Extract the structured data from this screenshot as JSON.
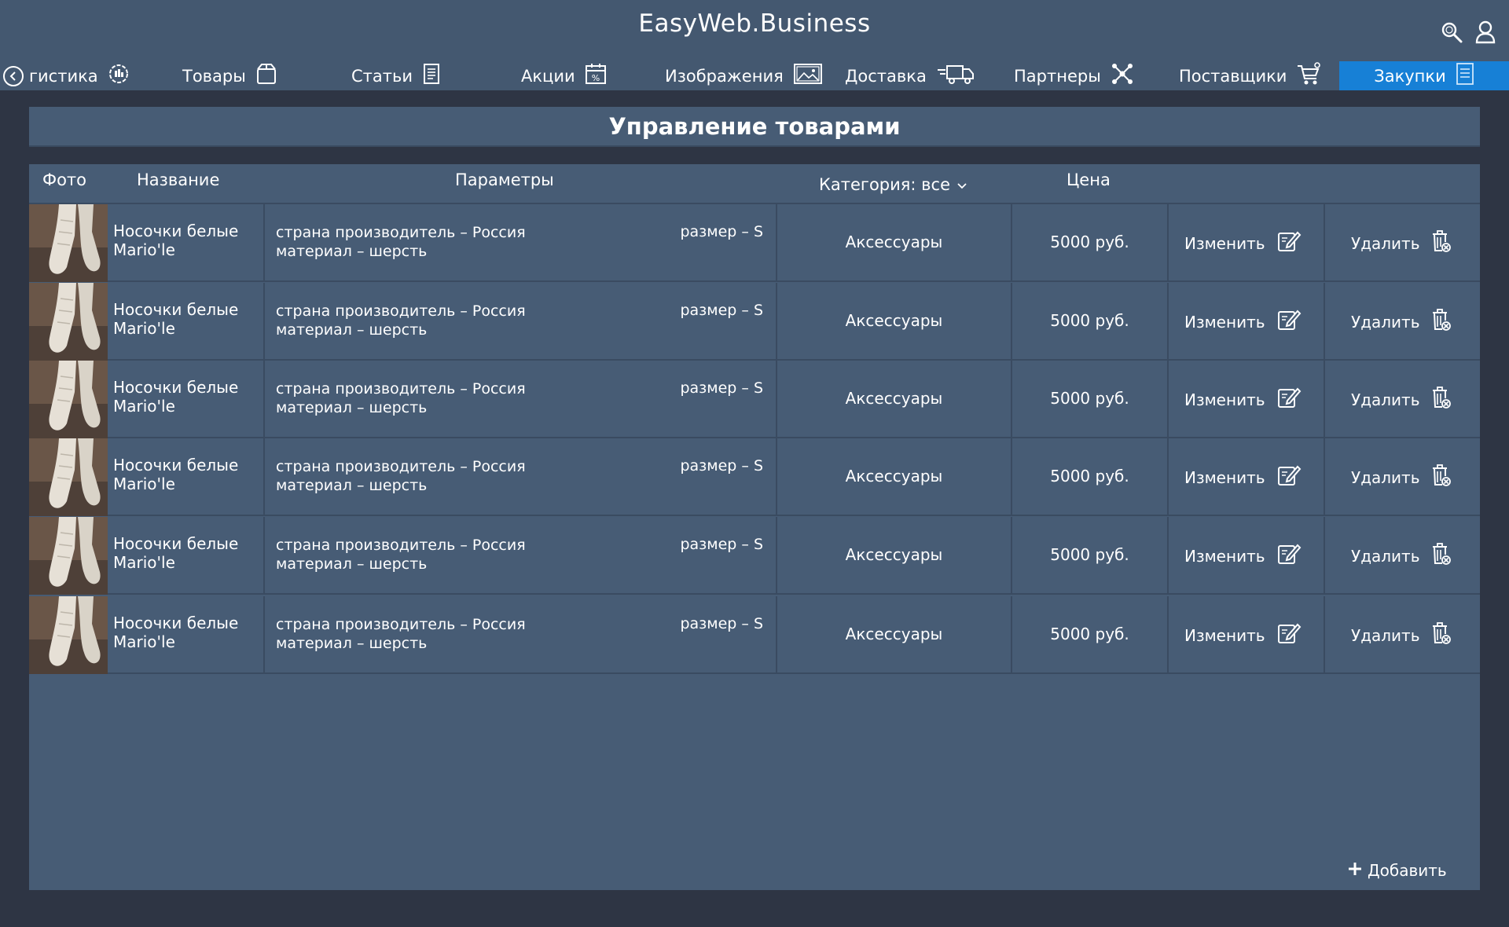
{
  "app": {
    "title": "EasyWeb.Business"
  },
  "header": {
    "search_icon": "search-icon",
    "user_icon": "user-icon"
  },
  "nav": {
    "items": [
      {
        "label": "гистика",
        "icon": "logistics-icon"
      },
      {
        "label": "Товары",
        "icon": "box-icon"
      },
      {
        "label": "Статьи",
        "icon": "document-icon"
      },
      {
        "label": "Акции",
        "icon": "percent-calendar-icon"
      },
      {
        "label": "Изображения",
        "icon": "image-icon"
      },
      {
        "label": "Доставка",
        "icon": "truck-icon"
      },
      {
        "label": "Партнеры",
        "icon": "network-icon"
      },
      {
        "label": "Поставщики",
        "icon": "cart-icon"
      },
      {
        "label": "Закупки",
        "icon": "list-icon",
        "active": true
      }
    ]
  },
  "main": {
    "title": "Управление товарами",
    "columns": {
      "photo": "Фото",
      "name": "Название",
      "params": "Параметры",
      "category": "Категория: все",
      "price": "Цена"
    },
    "rows": [
      {
        "name": "Носочки белые Mario'le",
        "param1": "страна производитель – Россия",
        "param2": "материал – шерсть",
        "size": "размер – S",
        "category": "Аксессуары",
        "price": "5000 руб.",
        "edit": "Изменить",
        "delete": "Удалить"
      },
      {
        "name": "Носочки белые Mario'le",
        "param1": "страна производитель – Россия",
        "param2": "материал – шерсть",
        "size": "размер – S",
        "category": "Аксессуары",
        "price": "5000 руб.",
        "edit": "Изменить",
        "delete": "Удалить"
      },
      {
        "name": "Носочки белые Mario'le",
        "param1": "страна производитель – Россия",
        "param2": "материал – шерсть",
        "size": "размер – S",
        "category": "Аксессуары",
        "price": "5000 руб.",
        "edit": "Изменить",
        "delete": "Удалить"
      },
      {
        "name": "Носочки белые Mario'le",
        "param1": "страна производитель – Россия",
        "param2": "материал – шерсть",
        "size": "размер – S",
        "category": "Аксессуары",
        "price": "5000 руб.",
        "edit": "Изменить",
        "delete": "Удалить"
      },
      {
        "name": "Носочки белые Mario'le",
        "param1": "страна производитель – Россия",
        "param2": "материал – шерсть",
        "size": "размер – S",
        "category": "Аксессуары",
        "price": "5000 руб.",
        "edit": "Изменить",
        "delete": "Удалить"
      },
      {
        "name": "Носочки белые Mario'le",
        "param1": "страна производитель – Россия",
        "param2": "материал – шерсть",
        "size": "размер – S",
        "category": "Аксессуары",
        "price": "5000 руб.",
        "edit": "Изменить",
        "delete": "Удалить"
      }
    ],
    "add_label": "Добавить"
  },
  "colors": {
    "header_bg": "#445870",
    "page_bg": "#2e3544",
    "panel_bg": "#475c75",
    "active_tab": "#1780d6"
  }
}
